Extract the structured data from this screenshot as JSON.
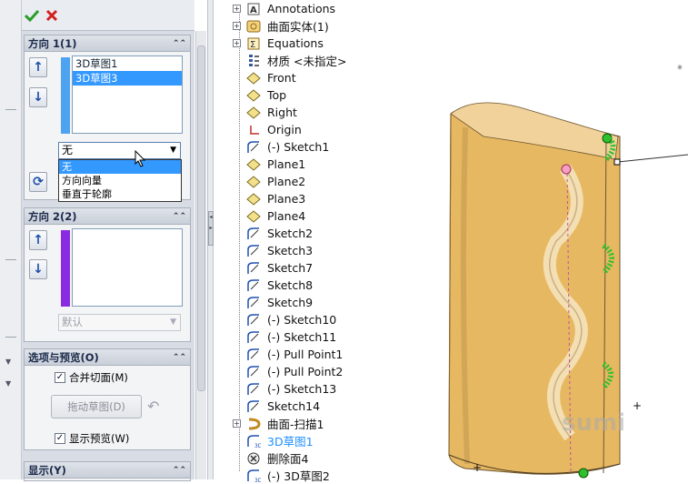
{
  "property_manager": {
    "ok_icon": "check-icon",
    "cancel_icon": "close-icon",
    "direction1": {
      "title": "方向 1(1)",
      "list_items": [
        "3D草图1",
        "3D草图3"
      ],
      "selected_index": 1,
      "tangent_dropdown_value": "无",
      "tangent_options": [
        "无",
        "方向向量",
        "垂直于轮廓"
      ],
      "highlighted_option": "无",
      "color": "#4da3f0"
    },
    "direction2": {
      "title": "方向 2(2)",
      "list_items": [],
      "tangent_dropdown_value": "默认",
      "color": "#8a2be2"
    },
    "options": {
      "title": "选项与预览(O)",
      "merge_faces_label": "合并切面(M)",
      "merge_faces_checked": true,
      "drag_sketch_button": "拖动草图(D)",
      "show_preview_label": "显示预览(W)",
      "show_preview_checked": true
    },
    "display": {
      "title": "显示(Y)"
    }
  },
  "feature_tree": [
    {
      "label": "Annotations",
      "icon": "annotations-icon",
      "expand": true
    },
    {
      "label": "曲面实体(1)",
      "icon": "surface-bodies-icon",
      "expand": true
    },
    {
      "label": "Equations",
      "icon": "equations-icon",
      "expand": true
    },
    {
      "label": "材质 <未指定>",
      "icon": "material-icon",
      "expand": false
    },
    {
      "label": "Front",
      "icon": "plane-icon",
      "expand": false
    },
    {
      "label": "Top",
      "icon": "plane-icon",
      "expand": false
    },
    {
      "label": "Right",
      "icon": "plane-icon",
      "expand": false
    },
    {
      "label": "Origin",
      "icon": "origin-icon",
      "expand": false
    },
    {
      "label": "(-) Sketch1",
      "icon": "sketch-icon",
      "expand": false
    },
    {
      "label": "Plane1",
      "icon": "plane-icon",
      "expand": false
    },
    {
      "label": "Plane2",
      "icon": "plane-icon",
      "expand": false
    },
    {
      "label": "Plane3",
      "icon": "plane-icon",
      "expand": false
    },
    {
      "label": "Plane4",
      "icon": "plane-icon",
      "expand": false
    },
    {
      "label": "Sketch2",
      "icon": "sketch-icon",
      "expand": false
    },
    {
      "label": "Sketch3",
      "icon": "sketch-icon",
      "expand": false
    },
    {
      "label": "Sketch7",
      "icon": "sketch-icon",
      "expand": false
    },
    {
      "label": "Sketch8",
      "icon": "sketch-icon",
      "expand": false
    },
    {
      "label": "Sketch9",
      "icon": "sketch-icon",
      "expand": false
    },
    {
      "label": "(-) Sketch10",
      "icon": "sketch-icon",
      "expand": false
    },
    {
      "label": "(-) Sketch11",
      "icon": "sketch-icon",
      "expand": false
    },
    {
      "label": "(-) Pull Point1",
      "icon": "sketch-icon",
      "expand": false
    },
    {
      "label": "(-) Pull Point2",
      "icon": "sketch-icon",
      "expand": false
    },
    {
      "label": "(-) Sketch13",
      "icon": "sketch-icon",
      "expand": false
    },
    {
      "label": "Sketch14",
      "icon": "sketch-icon",
      "expand": false
    },
    {
      "label": "曲面-扫描1",
      "icon": "sweep-surface-icon",
      "expand": true
    },
    {
      "label": "3D草图1",
      "icon": "3d-sketch-icon",
      "expand": false,
      "highlight": true
    },
    {
      "label": "删除面4",
      "icon": "delete-face-icon",
      "expand": false
    },
    {
      "label": "(-) 3D草图2",
      "icon": "3d-sketch-icon",
      "expand": false
    }
  ],
  "viewport": {
    "watermark": "sumi",
    "model_color": "#e5b45c"
  }
}
